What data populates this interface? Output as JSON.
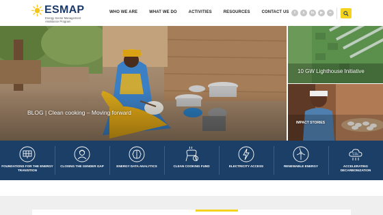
{
  "header": {
    "logo_text": "ESMAP",
    "logo_subtitle": "Energy Sector Management Assistance Program",
    "nav": [
      "WHO WE ARE",
      "WHAT WE DO",
      "ACTIVITIES",
      "RESOURCES",
      "CONTACT US"
    ],
    "socials": [
      {
        "icon": "facebook-icon",
        "glyph": "f"
      },
      {
        "icon": "x-twitter-icon",
        "glyph": "x"
      },
      {
        "icon": "linkedin-icon",
        "glyph": "in"
      },
      {
        "icon": "youtube-icon",
        "glyph": "▶"
      },
      {
        "icon": "flickr-icon",
        "glyph": "••"
      }
    ],
    "search_icon": "search-icon"
  },
  "hero": {
    "main_caption": "BLOG | Clean cooking – Moving forward",
    "side_top_title": "10 GW Lighthouse Initiative",
    "side_bottom_title": "IMPACT STORIES"
  },
  "focus_areas": [
    {
      "icon": "solar-panel-icon",
      "label": "FOUNDATIONS FOR THE ENERGY TRANSITION"
    },
    {
      "icon": "woman-icon",
      "label": "CLOSING THE GENDER GAP"
    },
    {
      "icon": "brain-icon",
      "label": "ENERGY DATA ANALYTICS"
    },
    {
      "icon": "cookstove-fund-icon",
      "label": "CLEAN COOKING FUND"
    },
    {
      "icon": "lightning-icon",
      "label": "ELECTRICITY ACCESS"
    },
    {
      "icon": "wind-turbine-icon",
      "label": "RENEWABLE ENERGY"
    },
    {
      "icon": "co2-cloud-icon",
      "label": "ACCELERATING DECARBONIZATION"
    }
  ],
  "colors": {
    "brand_navy": "#1c3f67",
    "brand_yellow": "#f5d31c",
    "logo_blue": "#1b3a6b"
  }
}
